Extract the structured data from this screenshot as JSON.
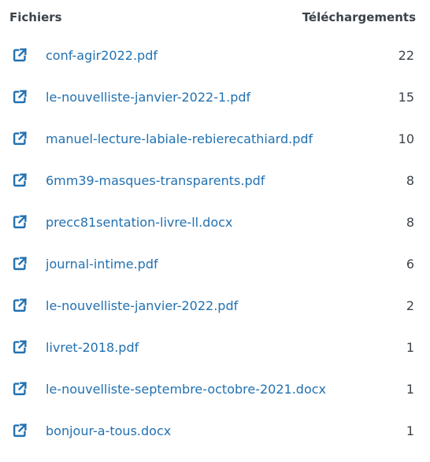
{
  "header": {
    "files_label": "Fichiers",
    "downloads_label": "Téléchargements"
  },
  "files": [
    {
      "name": "conf-agir2022.pdf",
      "downloads": "22"
    },
    {
      "name": "le-nouvelliste-janvier-2022-1.pdf",
      "downloads": "15"
    },
    {
      "name": "manuel-lecture-labiale-rebierecathiard.pdf",
      "downloads": "10"
    },
    {
      "name": "6mm39-masques-transparents.pdf",
      "downloads": "8"
    },
    {
      "name": "precc81sentation-livre-ll.docx",
      "downloads": "8"
    },
    {
      "name": "journal-intime.pdf",
      "downloads": "6"
    },
    {
      "name": "le-nouvelliste-janvier-2022.pdf",
      "downloads": "2"
    },
    {
      "name": "livret-2018.pdf",
      "downloads": "1"
    },
    {
      "name": "le-nouvelliste-septembre-octobre-2021.docx",
      "downloads": "1"
    },
    {
      "name": "bonjour-a-tous.docx",
      "downloads": "1"
    }
  ],
  "colors": {
    "link": "#2271b1",
    "text": "#3c434a"
  },
  "icons": {
    "row_icon": "external-link-icon"
  }
}
